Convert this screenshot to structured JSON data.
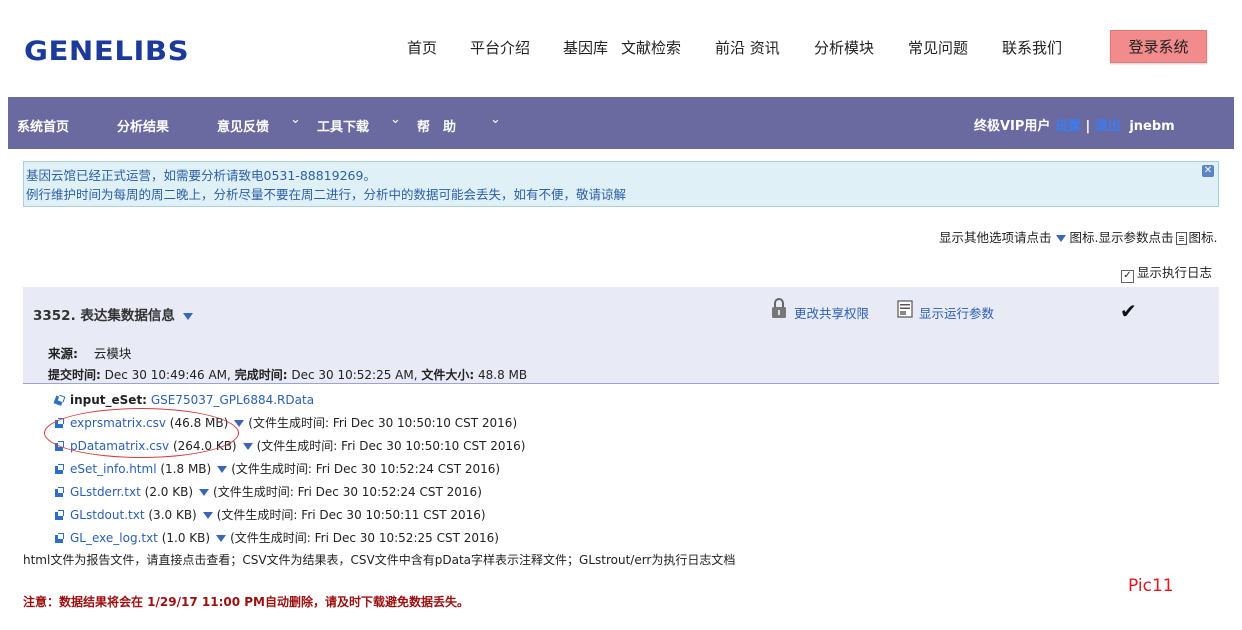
{
  "logo": "GENELIBS",
  "top_nav": [
    "首页",
    "平台介绍",
    "基因库",
    "文献检索",
    "前沿 资讯",
    "分析模块",
    "常见问题",
    "联系我们"
  ],
  "login_label": "登录系统",
  "main_nav": {
    "items": [
      "系统首页",
      "分析结果",
      "意见反馈",
      "工具下载",
      "帮　助"
    ],
    "user_role": "终极VIP用户",
    "settings": "设置",
    "separator": "|",
    "logout": "退出",
    "username": "jnebm"
  },
  "notice": {
    "line1": "基因云馆已经正式运营，如需要分析请致电0531-88819269。",
    "line2": "例行维护时间为每周的周二晚上，分析尽量不要在周二进行，分析中的数据可能会丢失，如有不便，敬请谅解"
  },
  "options": {
    "other_prefix": "显示其他选项请点击",
    "icon_word1": "图标.",
    "params_prefix": "显示参数点击",
    "icon_word2": "图标.",
    "exec_log": "显示执行日志"
  },
  "panel": {
    "title": "3352. 表达集数据信息",
    "share": "更改共享权限",
    "params": "显示运行参数",
    "check": "✔",
    "source_label": "来源:",
    "source_value": "云模块",
    "submit_label": "提交时间:",
    "submit_value": "Dec 30 10:49:46 AM,",
    "finish_label": "完成时间:",
    "finish_value": "Dec 30 10:52:25 AM,",
    "size_label": "文件大小:",
    "size_value": "48.8 MB"
  },
  "input_file": {
    "label": "input_eSet:",
    "name": "GSE75037_GPL6884.RData"
  },
  "files": [
    {
      "name": "exprsmatrix.csv",
      "size": "(46.8 MB)",
      "generated": "(文件生成时间: Fri Dec 30 10:50:10 CST 2016)"
    },
    {
      "name": "pDatamatrix.csv",
      "size": "(264.0 KB)",
      "generated": "(文件生成时间: Fri Dec 30 10:50:10 CST 2016)"
    },
    {
      "name": "eSet_info.html",
      "size": "(1.8 MB)",
      "generated": "(文件生成时间: Fri Dec 30 10:52:24 CST 2016)"
    },
    {
      "name": "GLstderr.txt",
      "size": "(2.0 KB)",
      "generated": "(文件生成时间: Fri Dec 30 10:52:24 CST 2016)"
    },
    {
      "name": "GLstdout.txt",
      "size": "(3.0 KB)",
      "generated": "(文件生成时间: Fri Dec 30 10:50:11 CST 2016)"
    },
    {
      "name": "GL_exe_log.txt",
      "size": "(1.0 KB)",
      "generated": "(文件生成时间: Fri Dec 30 10:52:25 CST 2016)"
    }
  ],
  "help_text": "html文件为报告文件，请直接点击查看；CSV文件为结果表，CSV文件中含有pData字样表示注释文件；GLstrout/err为执行日志文档",
  "pic_label": "Pic11",
  "warning": "注意：数据结果将会在 1/29/17 11:00 PM自动删除，请及时下载避免数据丢失。",
  "colors": {
    "nav_bar": "#6a6aa1",
    "logo": "#1b3a9a",
    "login_button": "#f28c8c",
    "link": "#2a5fb4",
    "warning": "#9c1010",
    "annotation": "#e0181e"
  }
}
